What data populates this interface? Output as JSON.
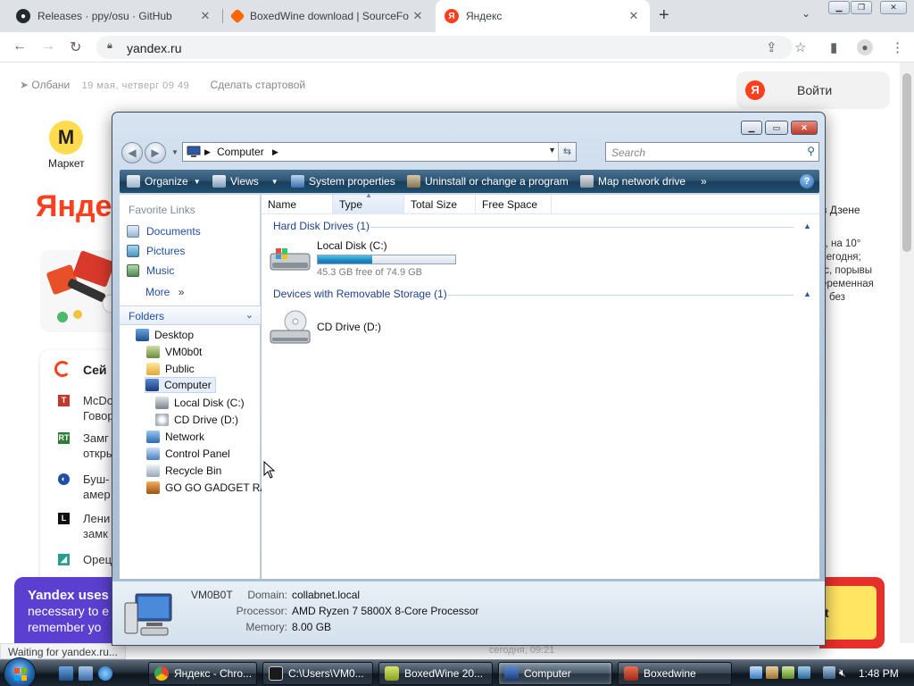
{
  "browser": {
    "tabs": [
      {
        "title": "Releases · ppy/osu · GitHub",
        "active": false
      },
      {
        "title": "BoxedWine download | SourceFo",
        "active": false
      },
      {
        "title": "Яндекс",
        "active": true
      }
    ],
    "url": "yandex.ru",
    "status": "Waiting for yandex.ru..."
  },
  "yandex": {
    "city": "Олбани",
    "date": "19 мая, четверг 09 49",
    "make_start": "Сделать стартовой",
    "login": "Войти",
    "market": "Маркет",
    "logo_partial": "Янде",
    "news_header": "Сей",
    "news": [
      "McDo",
      "Говор",
      "Замг",
      "откры",
      "Буш-",
      "амер",
      "Лени",
      "замк",
      "Орец"
    ],
    "zen": "в Дзене",
    "weather": [
      "°, на 10°",
      "сегодня;",
      "/с, порывы",
      "еременная",
      "без"
    ],
    "cookie_l1": "Yandex uses",
    "cookie_l2": "necessary to e",
    "cookie_l3": "remember yo",
    "cookie_btn": "t",
    "below": "сегодня, 09:21"
  },
  "explorer": {
    "address": [
      "Computer"
    ],
    "search_placeholder": "Search",
    "commands": {
      "organize": "Organize",
      "views": "Views",
      "system_properties": "System properties",
      "uninstall": "Uninstall or change a program",
      "map_drive": "Map network drive",
      "more": "»"
    },
    "favorites_header": "Favorite Links",
    "favorites": [
      "Documents",
      "Pictures",
      "Music"
    ],
    "more": "More",
    "folders_header": "Folders",
    "tree": [
      "Desktop",
      "VM0b0t",
      "Public",
      "Computer",
      "Local Disk (C:)",
      "CD Drive (D:)",
      "Network",
      "Control Panel",
      "Recycle Bin",
      "GO GO GADGET RA"
    ],
    "columns": [
      "Name",
      "Type",
      "Total Size",
      "Free Space"
    ],
    "groups": {
      "hdd": "Hard Disk Drives (1)",
      "removable": "Devices with Removable Storage (1)"
    },
    "drives": {
      "c_name": "Local Disk (C:)",
      "c_free": "45.3 GB free of 74.9 GB",
      "c_used_fraction": 0.395,
      "d_name": "CD Drive (D:)"
    },
    "details": {
      "computer_name": "VM0B0T",
      "domain_label": "Domain:",
      "domain": "collabnet.local",
      "processor_label": "Processor:",
      "processor": "AMD Ryzen 7 5800X 8-Core Processor",
      "memory_label": "Memory:",
      "memory": "8.00 GB"
    }
  },
  "taskbar": {
    "tasks": [
      {
        "title": "Яндекс - Chro...",
        "active": false
      },
      {
        "title": "C:\\Users\\VM0...",
        "active": false
      },
      {
        "title": "BoxedWine 20...",
        "active": false
      },
      {
        "title": "Computer",
        "active": true
      },
      {
        "title": "Boxedwine",
        "active": false
      }
    ],
    "clock": "1:48 PM"
  },
  "colors": {
    "yandex_red": "#fc3f1d",
    "vista_cmdbar": "#2c5473",
    "drive_bar": "#1e88c4",
    "link_blue": "#1e4ea5"
  }
}
